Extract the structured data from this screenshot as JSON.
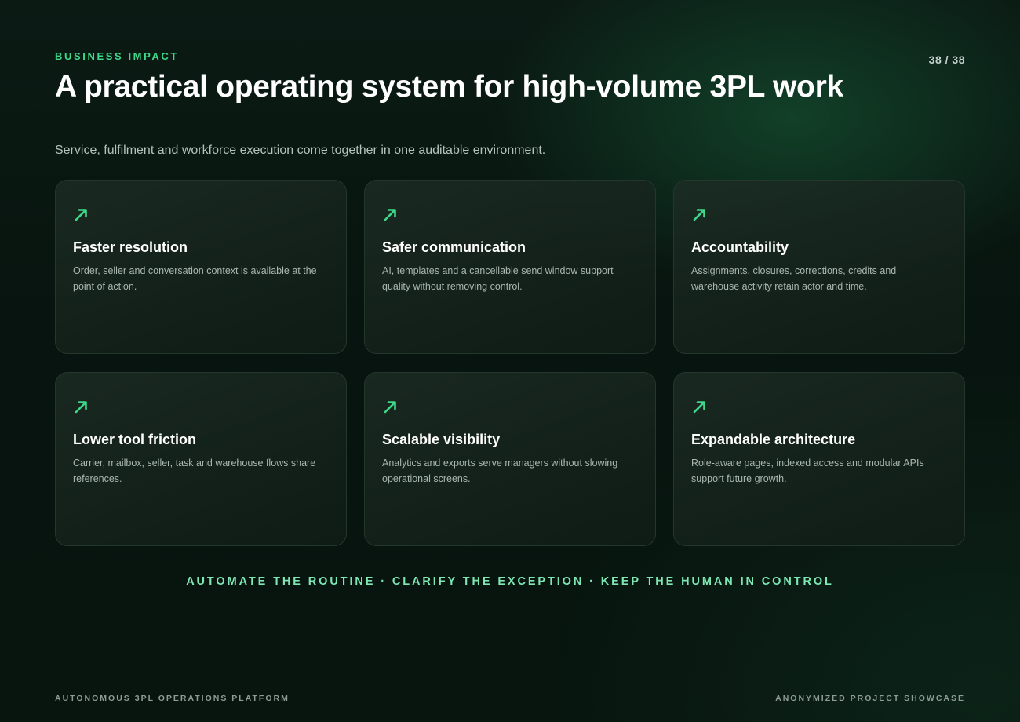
{
  "header": {
    "eyebrow": "BUSINESS IMPACT",
    "page_number": "38 / 38",
    "title": "A practical operating system for high-volume 3PL work",
    "subtitle": "Service, fulfilment and workforce execution come together in one auditable environment."
  },
  "cards": [
    {
      "icon": "arrow-up-right-icon",
      "title": "Faster resolution",
      "description": "Order, seller and conversation context is available at the point of action."
    },
    {
      "icon": "arrow-up-right-icon",
      "title": "Safer communication",
      "description": "AI, templates and a cancellable send window support quality without removing control."
    },
    {
      "icon": "arrow-up-right-icon",
      "title": "Accountability",
      "description": "Assignments, closures, corrections, credits and warehouse activity retain actor and time."
    },
    {
      "icon": "arrow-up-right-icon",
      "title": "Lower tool friction",
      "description": "Carrier, mailbox, seller, task and warehouse flows share references."
    },
    {
      "icon": "arrow-up-right-icon",
      "title": "Scalable visibility",
      "description": "Analytics and exports serve managers without slowing operational screens."
    },
    {
      "icon": "arrow-up-right-icon",
      "title": "Expandable architecture",
      "description": "Role-aware pages, indexed access and modular APIs support future growth."
    }
  ],
  "tagline": "AUTOMATE THE ROUTINE · CLARIFY THE EXCEPTION · KEEP THE HUMAN IN CONTROL",
  "footer": {
    "left": "AUTONOMOUS 3PL OPERATIONS PLATFORM",
    "right": "ANONYMIZED PROJECT SHOWCASE"
  },
  "colors": {
    "accent": "#3fd88a",
    "tagline": "#7ee8b4",
    "background": "#0b1b14"
  }
}
